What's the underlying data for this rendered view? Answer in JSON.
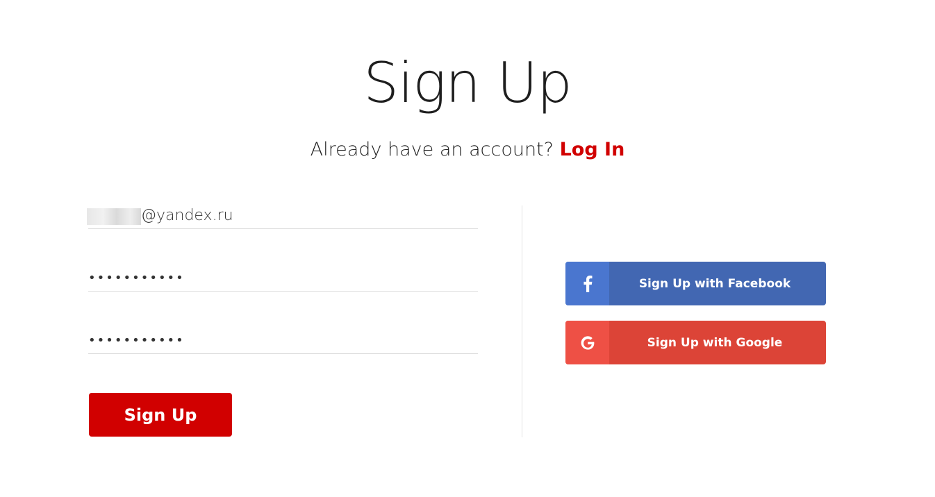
{
  "header": {
    "title": "Sign Up",
    "prompt": "Already have an account?",
    "login_link": "Log In"
  },
  "form": {
    "email_value": "@yandex.ru",
    "password_value": "•••••••••••",
    "confirm_password_value": "•••••••••••",
    "submit_label": "Sign Up"
  },
  "social": {
    "facebook_label": "Sign Up with Facebook",
    "facebook_icon": "facebook-icon",
    "google_label": "Sign Up with Google",
    "google_icon": "google-icon"
  },
  "colors": {
    "accent": "#d10000",
    "facebook": "#4267b2",
    "google": "#dc4437"
  }
}
